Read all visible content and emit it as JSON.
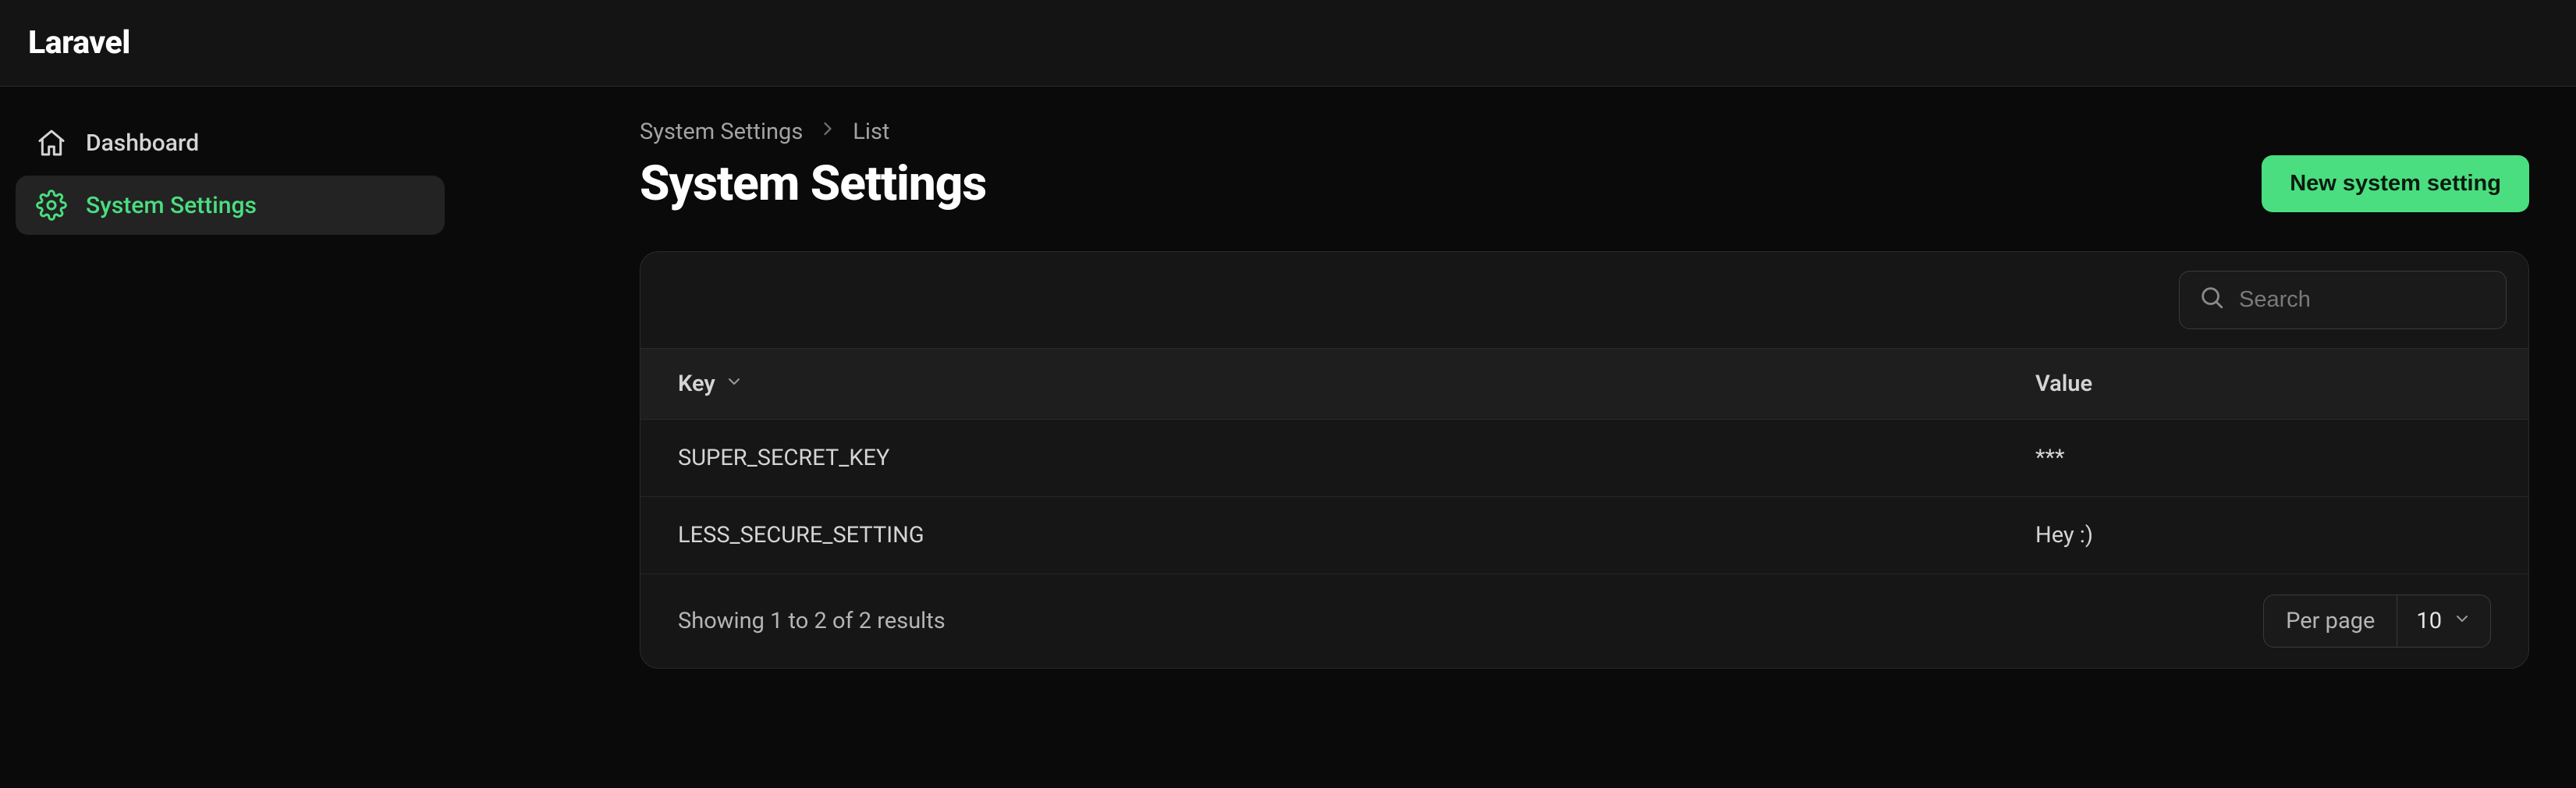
{
  "brand": "Laravel",
  "sidebar": {
    "items": [
      {
        "label": "Dashboard"
      },
      {
        "label": "System Settings"
      }
    ]
  },
  "breadcrumb": {
    "items": [
      "System Settings",
      "List"
    ]
  },
  "page_title": "System Settings",
  "primary_button_label": "New system setting",
  "search": {
    "placeholder": "Search",
    "value": ""
  },
  "table": {
    "columns": [
      {
        "label": "Key",
        "sortable": true
      },
      {
        "label": "Value",
        "sortable": false
      }
    ],
    "rows": [
      {
        "key": "SUPER_SECRET_KEY",
        "value": "***"
      },
      {
        "key": "LESS_SECURE_SETTING",
        "value": "Hey :)"
      }
    ]
  },
  "footer": {
    "results_text": "Showing 1 to 2 of 2 results",
    "per_page_label": "Per page",
    "per_page_value": "10"
  },
  "colors": {
    "accent": "#4ade80",
    "bg": "#0a0a0a",
    "panel": "#161616"
  }
}
